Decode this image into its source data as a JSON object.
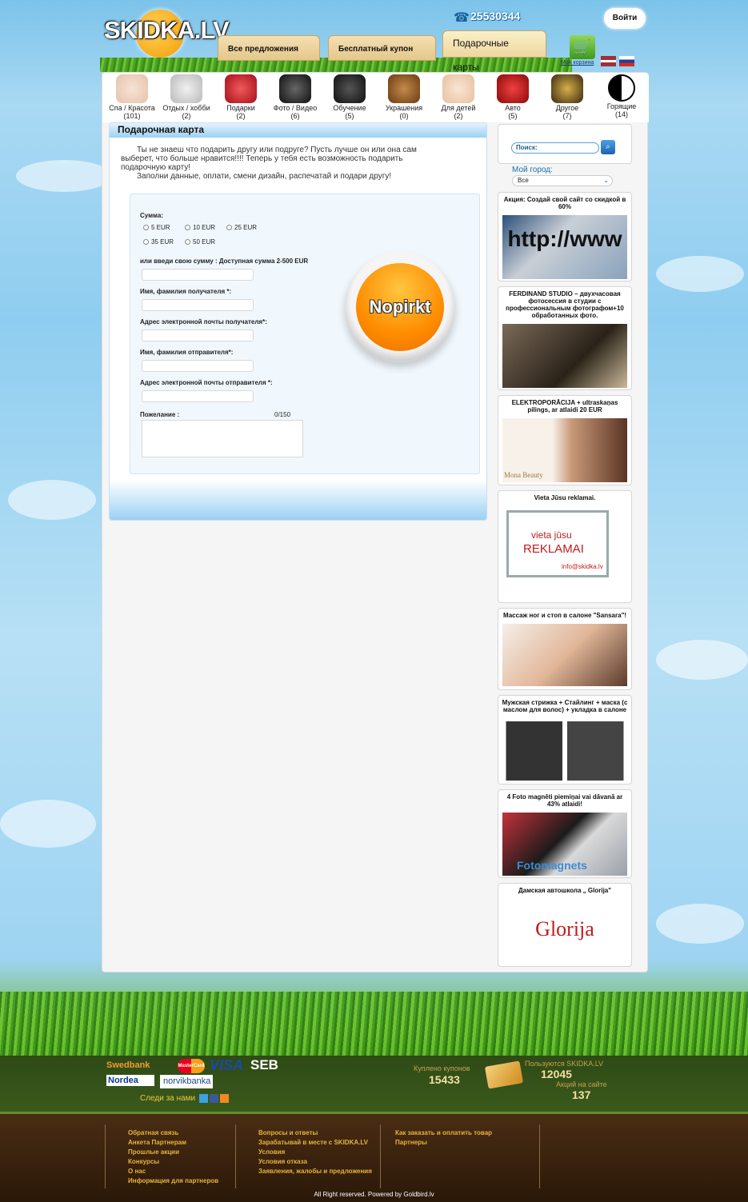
{
  "header": {
    "logo_text": "SKIDKA.LV",
    "phone": "25530344",
    "login_label": "Войти",
    "tabs": [
      "Все предложения",
      "Бесплатный купон",
      "Подарочные карты"
    ],
    "cart_label": "Моя корзина"
  },
  "categories": [
    {
      "label": "Спа / Красота",
      "count": "(101)"
    },
    {
      "label": "Отдых / хобби",
      "count": "(2)"
    },
    {
      "label": "Подарки",
      "count": "(2)"
    },
    {
      "label": "Фото / Видео",
      "count": "(6)"
    },
    {
      "label": "Обучение",
      "count": "(5)"
    },
    {
      "label": "Украшения",
      "count": "(0)"
    },
    {
      "label": "Для детей",
      "count": "(2)"
    },
    {
      "label": "Авто",
      "count": "(5)"
    },
    {
      "label": "Другое",
      "count": "(7)"
    },
    {
      "label": "Горящие",
      "count": "(14)"
    }
  ],
  "main": {
    "title": "Подарочная карта",
    "intro_1": "Ты не знаеш что подарить другу или подруге? Пусть лучше он или она сам выберет, что больше нравится!!!! Теперь у тебя есть возможность подарить подарочную карту!",
    "intro_2": "Заполни данные, оплати, смени дизайн, распечатай и подари другу!",
    "form": {
      "sum_label": "Сумма:",
      "amounts": [
        "5 EUR",
        "10 EUR",
        "25 EUR",
        "35 EUR",
        "50 EUR"
      ],
      "custom_sum_label": "или введи свою сумму : Доступная сумма 2-500 EUR",
      "recipient_name_label": "Имя, фамилия получателя *:",
      "recipient_email_label": "Адрес электронной почты получателя*:",
      "sender_name_label": "Имя, фамилия отправителя*:",
      "sender_email_label": "Адрес электронной почты отправителя *:",
      "wish_label": "Пожелание :",
      "wish_counter": "0/150",
      "buy_label": "Nopirkt"
    }
  },
  "sidebar": {
    "search_placeholder": "Поиск:",
    "city_label": "Мой город:",
    "city_value": "Все",
    "promos": [
      {
        "title": "Акция: Создай свой сайт со скидкой в 60%",
        "image_text": "http://www"
      },
      {
        "title": "FERDINAND STUDIO – двухчасовая фотосессия в студии с профессиональным фотографом+10 обработанных фото.",
        "image_text": ""
      },
      {
        "title": "ELEKTROPORĀCIJA + ultraskaņas pilings, ar atlaidi 20 EUR",
        "image_text": "Mona Beauty"
      },
      {
        "title": "Vieta Jūsu reklamai.",
        "image_text_1": "vieta jūsu",
        "image_text_2": "REKLAMAI",
        "image_text_3": "info@skidka.lv"
      },
      {
        "title": "Массаж ног и стоп в салоне \"Sansara\"!",
        "image_text": ""
      },
      {
        "title": "Мужская стрижка + Стайлинг + маска (с маслом для волос) + укладка в салоне",
        "image_text": ""
      },
      {
        "title": "4 Foto magnēti piemiņai vai dāvanā ar 43% atlaidi!",
        "image_text": "Fotomagnets"
      },
      {
        "title": "Дамская автошкола „ Glorija\"",
        "image_text": "Glorija"
      }
    ]
  },
  "footer": {
    "banks": [
      "Swedbank",
      "MasterCard",
      "VISA",
      "SEB",
      "Nordea",
      "norvikbanka"
    ],
    "follow_label": "Следи за нами",
    "coupons_bought_label": "Куплено купонов",
    "coupons_bought_value": "15433",
    "users_label": "Пользуются SKIDKA.LV",
    "users_value": "12045",
    "deals_label": "Акций на сайте",
    "deals_value": "137",
    "links_col1": [
      "Обратная связь",
      "Анкета Партнерам",
      "Прошлые акции",
      "Конкурсы",
      "О нас",
      "Информация для партнеров"
    ],
    "links_col2": [
      "Вопросы и ответы",
      "Зарабатывай в месте с SKIDKA.LV",
      "Условия",
      "Условия отказа",
      "Заявления, жалобы и предложения"
    ],
    "links_col3": [
      "Как заказать и оплатить товар",
      "Партнеры"
    ],
    "copyright": "All Right reserved. Powered by Goldbird.lv"
  },
  "colors": {
    "sky": "#8fcdf0",
    "panel_header": "#9cd1f4",
    "buy_button": "#ff8c00",
    "footer_link": "#e6b43c"
  }
}
